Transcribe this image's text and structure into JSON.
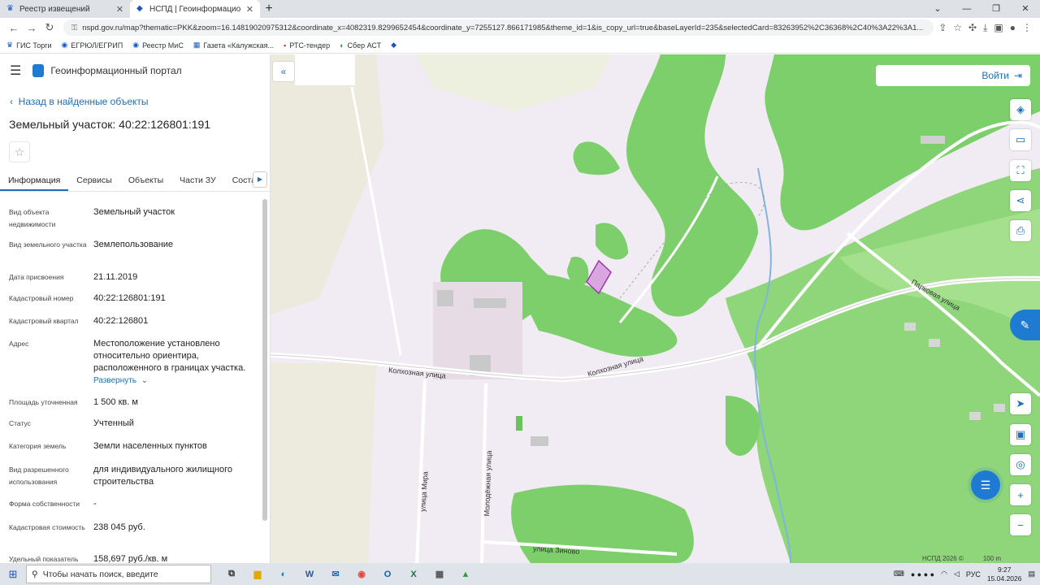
{
  "browser": {
    "tabs": [
      {
        "title": "Реестр извещений",
        "active": false
      },
      {
        "title": "НСПД | Геоинформационный п",
        "active": true
      }
    ],
    "new_tab": "+",
    "url": "nspd.gov.ru/map?thematic=PKK&zoom=16.14819020975312&coordinate_x=4082319.8299652454&coordinate_y=7255127.866171985&theme_id=1&is_copy_url=true&baseLayerId=235&selectedCard=83263952%2C36368%2C40%3A22%3A1...",
    "bookmarks": [
      "ГИС Торги",
      "ЕГРЮЛ/ЕГРИП",
      "Реестр МиС",
      "Газета «Калужская...",
      "РТС-тендер",
      "Сбер АСТ"
    ]
  },
  "portal": {
    "title": "Геоинформационный портал",
    "back_label": "Назад в найденные объекты",
    "object_title": "Земельный участок: 40:22:126801:191",
    "tabs": [
      "Информация",
      "Сервисы",
      "Объекты",
      "Части ЗУ",
      "Состав"
    ],
    "properties": [
      {
        "key": "Вид объекта недвижимости",
        "value": "Земельный участок"
      },
      {
        "key": "Вид земельного участка",
        "value": "Землепользование"
      },
      {
        "key": "Дата присвоения",
        "value": "21.11.2019"
      },
      {
        "key": "Кадастровый номер",
        "value": "40:22:126801:191"
      },
      {
        "key": "Кадастровый квартал",
        "value": "40:22:126801"
      },
      {
        "key": "Адрес",
        "value": "Местоположение установлено относительно ориентира, расположенного в границах участка.",
        "link": "Развернуть"
      },
      {
        "key": "Площадь уточненная",
        "value": "1 500 кв. м"
      },
      {
        "key": "Статус",
        "value": "Учтенный"
      },
      {
        "key": "Категория земель",
        "value": "Земли населенных пунктов"
      },
      {
        "key": "Вид разрешенного использования",
        "value": "для индивидуального жилищного строительства"
      },
      {
        "key": "Форма собственности",
        "value": "-"
      },
      {
        "key": "Кадастровая стоимость",
        "value": "238 045 руб."
      },
      {
        "key": "Удельный показатель",
        "value": "158,697 руб./кв. м"
      }
    ]
  },
  "map": {
    "login_label": "Войти",
    "streets": [
      "Колхозная улица",
      "Колхозная улица",
      "улица Мира",
      "Молодёжная улица",
      "улица Зиново",
      "Парковая улица"
    ],
    "footer_copyright": "НСПД 2026 ©",
    "footer_scale": "100 m"
  },
  "taskbar": {
    "search_placeholder": "Чтобы начать поиск, введите",
    "lang": "РУС",
    "time": "9:27",
    "date": "15.04.2026"
  },
  "colors": {
    "accent": "#1f6fb7",
    "forest": "#7ccf6b",
    "map_bg": "#f1ecf4",
    "parcel": "#d9a6e0"
  }
}
